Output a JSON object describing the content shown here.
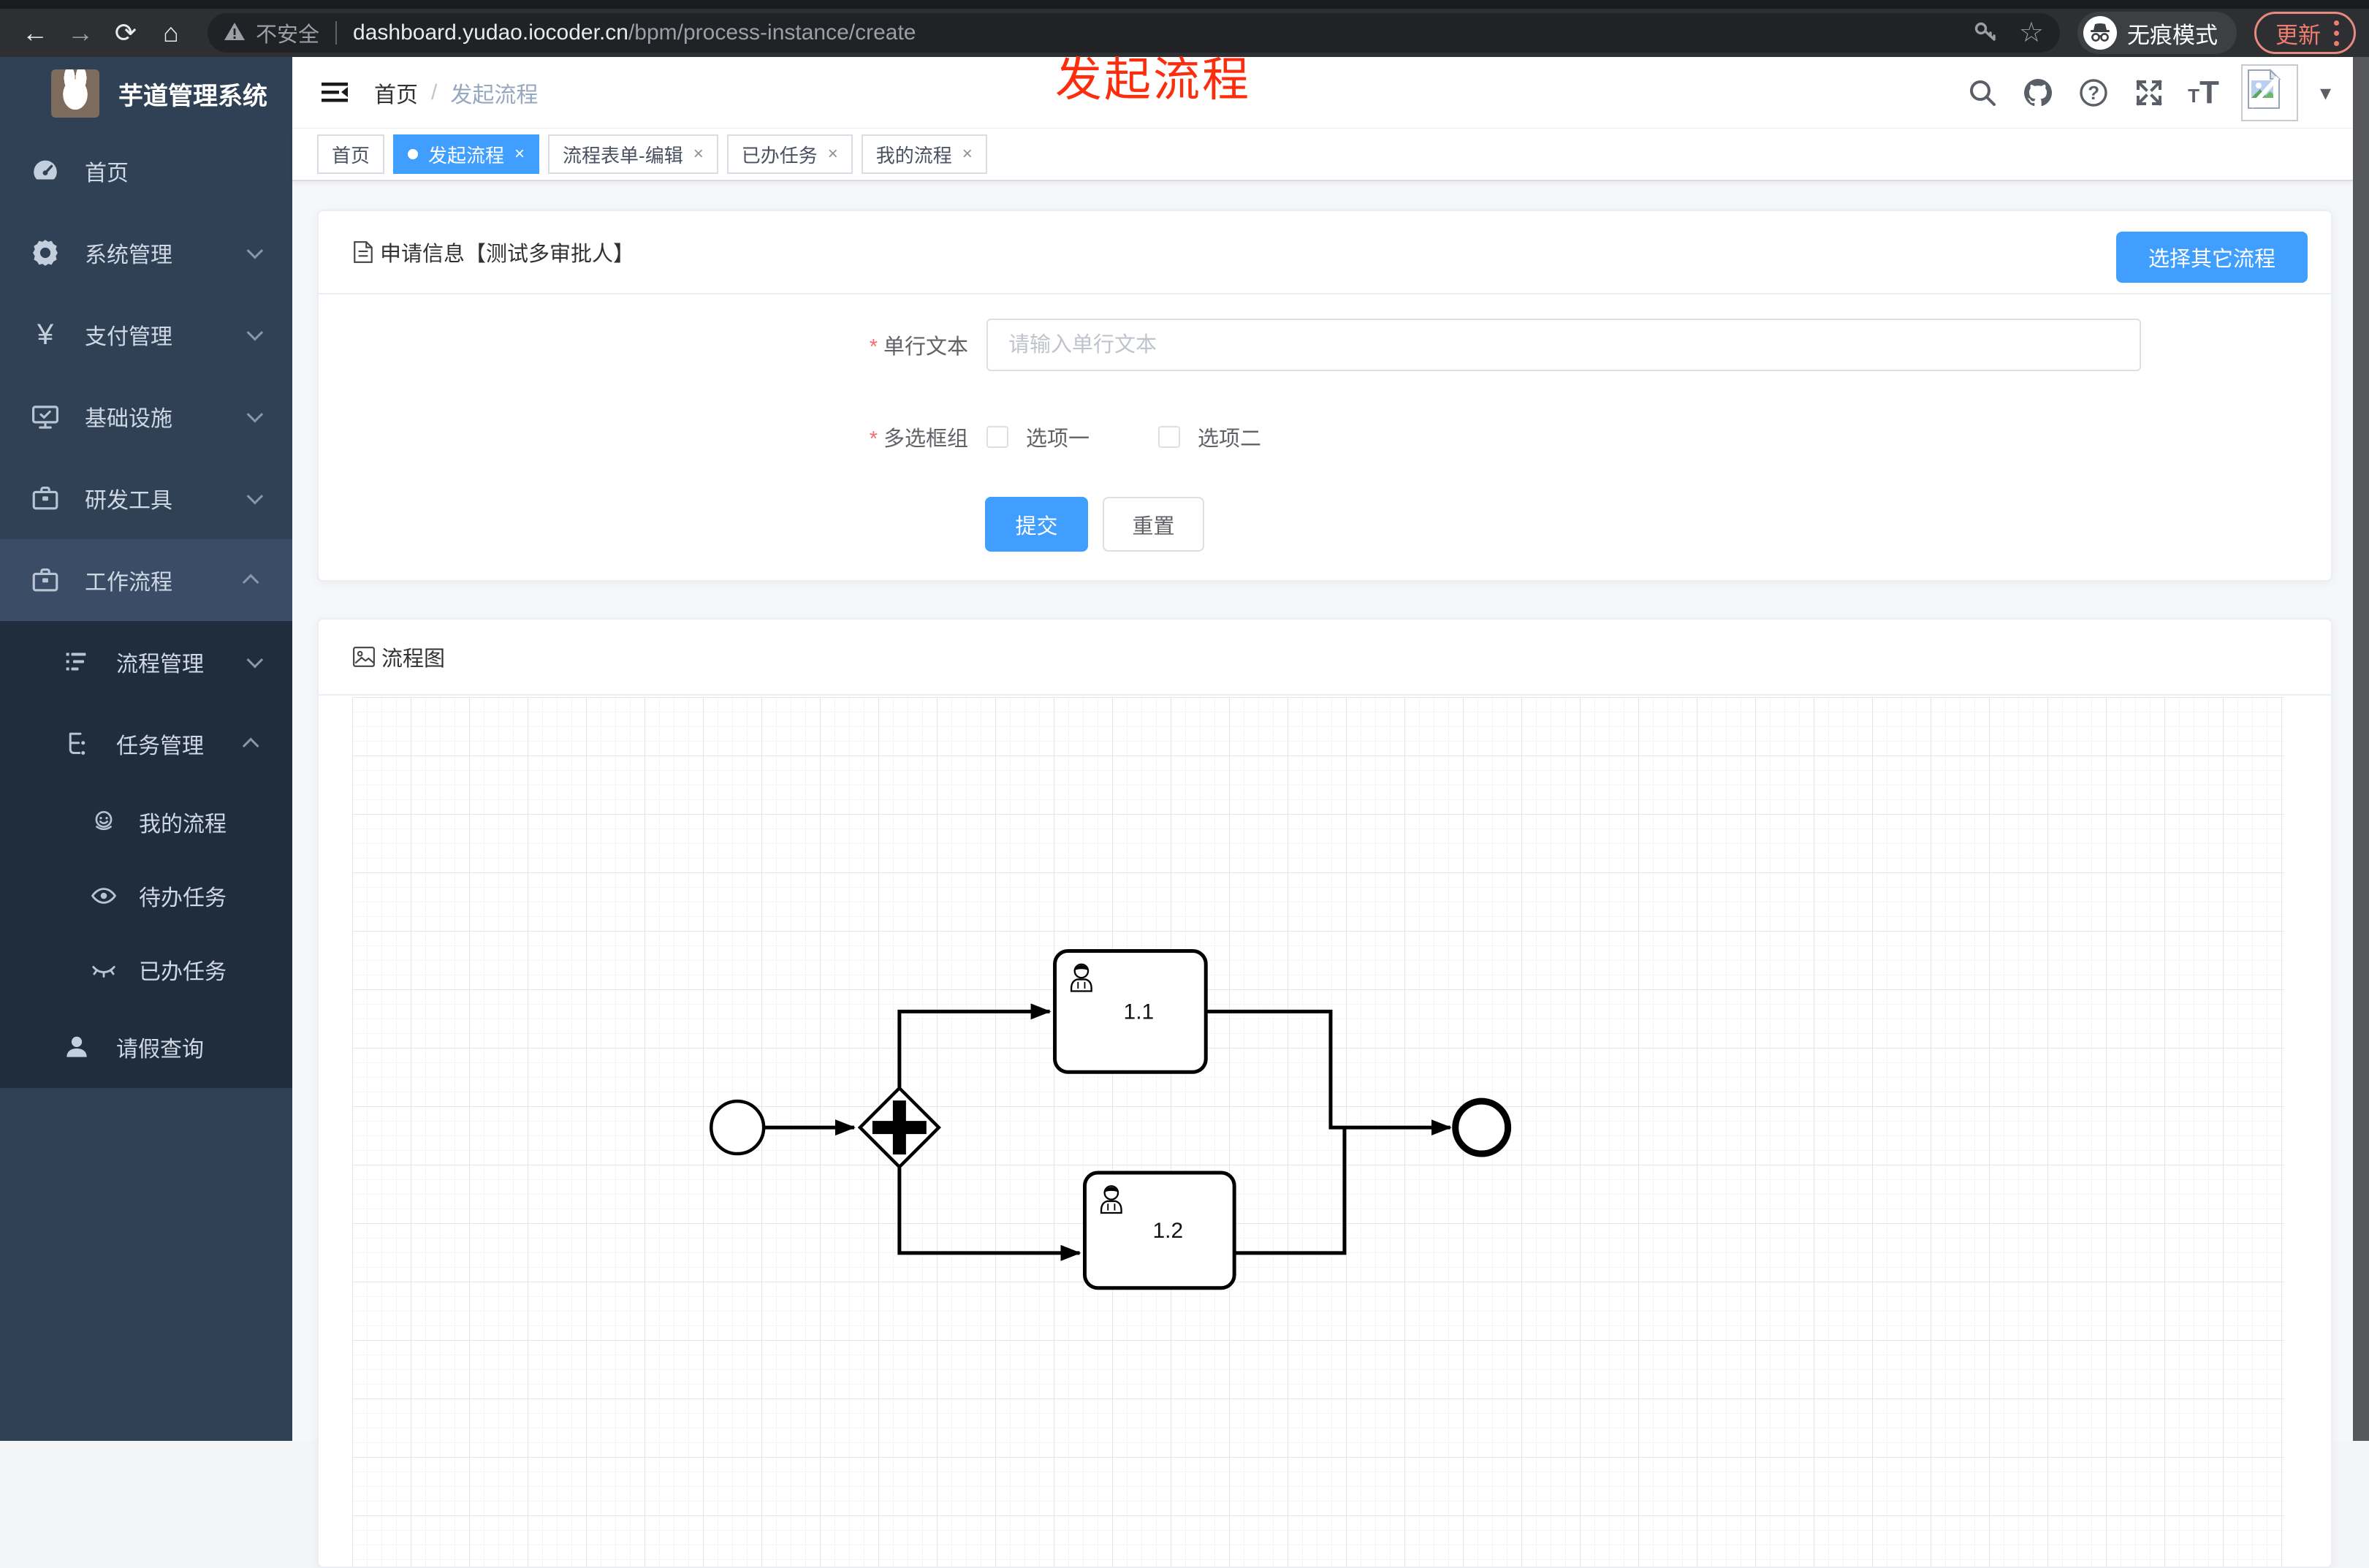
{
  "colors": {
    "accent_blue": "#409eff",
    "sidebar_bg": "#304156",
    "sidebar_submenu_bg": "#1f2d3d",
    "chrome_bg": "#2e2f33",
    "annotation_red": "#fb2d0c",
    "update_red": "#ee7c6f",
    "required_red": "#f56c6c",
    "tab_border": "#d8dce5",
    "diagram_stroke": "#000000"
  },
  "browser": {
    "security_label": "不安全",
    "url_host": "dashboard.yudao.iocoder.cn",
    "url_path": "/bpm/process-instance/create",
    "incognito_label": "无痕模式",
    "update_label": "更新"
  },
  "annotation": {
    "text": "发起流程"
  },
  "sidebar": {
    "app_title": "芋道管理系统",
    "items": [
      {
        "label": "首页"
      },
      {
        "label": "系统管理"
      },
      {
        "label": "支付管理"
      },
      {
        "label": "基础设施"
      },
      {
        "label": "研发工具"
      },
      {
        "label": "工作流程"
      },
      {
        "label": "流程管理"
      },
      {
        "label": "任务管理"
      },
      {
        "label": "我的流程"
      },
      {
        "label": "待办任务"
      },
      {
        "label": "已办任务"
      },
      {
        "label": "请假查询"
      }
    ]
  },
  "navbar": {
    "breadcrumb_home": "首页",
    "breadcrumb_sep": "/",
    "breadcrumb_current": "发起流程"
  },
  "tabs": [
    {
      "label": "首页"
    },
    {
      "label": "发起流程"
    },
    {
      "label": "流程表单-编辑"
    },
    {
      "label": "已办任务"
    },
    {
      "label": "我的流程"
    }
  ],
  "form_card": {
    "title": "申请信息【测试多审批人】",
    "choose_other_button": "选择其它流程",
    "required_mark": "*",
    "text_field": {
      "label": "单行文本",
      "placeholder": "请输入单行文本",
      "value": ""
    },
    "checkbox_group": {
      "label": "多选框组",
      "option1": "选项一",
      "option2": "选项二"
    },
    "submit_button": "提交",
    "reset_button": "重置"
  },
  "flow_card": {
    "title": "流程图",
    "task1_label": "1.1",
    "task2_label": "1.2"
  },
  "icons": {
    "back": "←",
    "forward": "→",
    "reload": "⟳",
    "home": "⌂",
    "star": "☆",
    "close": "×",
    "caret": "▾",
    "question": "?",
    "letter_t": "T"
  }
}
